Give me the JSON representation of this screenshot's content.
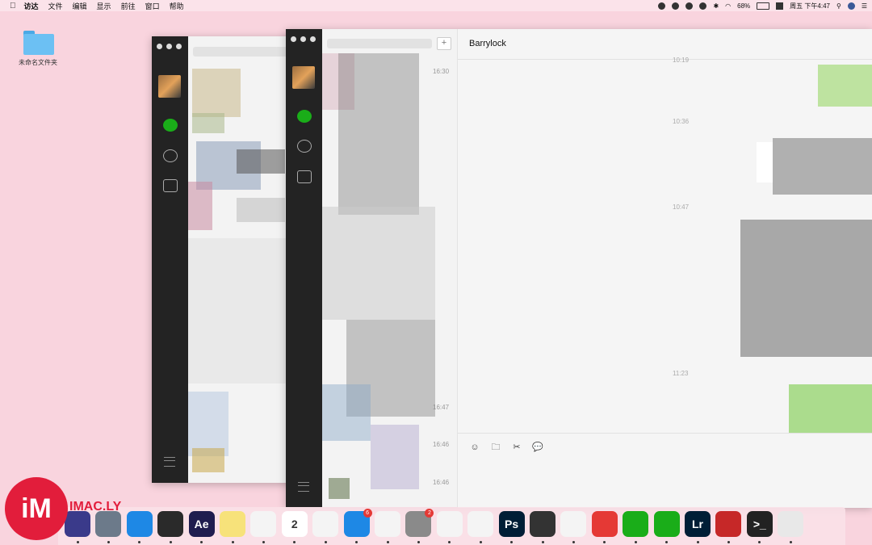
{
  "menubar": {
    "items": [
      "访达",
      "文件",
      "编辑",
      "显示",
      "前往",
      "窗口",
      "帮助"
    ],
    "battery": "68%",
    "clock": "周五 下午4:47"
  },
  "desktop": {
    "folder_label": "未命名文件夹"
  },
  "back_window": {
    "list_items": [
      {
        "time": ""
      },
      {
        "time": ""
      }
    ]
  },
  "front_window": {
    "list_times": [
      "16:30",
      "16:47",
      "16:46",
      "16:46"
    ],
    "add_button": "+"
  },
  "chat": {
    "title": "Barrylock",
    "timestamps": [
      "10:19",
      "10:36",
      "10:47",
      "11:23"
    ]
  },
  "dock": {
    "apps": [
      {
        "name": "siri",
        "label": "",
        "color": "#3a3a8a"
      },
      {
        "name": "launchpad",
        "label": "",
        "color": "#6c7a8a"
      },
      {
        "name": "safari",
        "label": "",
        "color": "#1e88e5"
      },
      {
        "name": "davinci-resolve",
        "label": "",
        "color": "#2a2a2a"
      },
      {
        "name": "after-effects",
        "label": "Ae",
        "color": "#1f1d4f"
      },
      {
        "name": "notes",
        "label": "",
        "color": "#f7e27a"
      },
      {
        "name": "photos",
        "label": "",
        "color": "#f4f4f4"
      },
      {
        "name": "calendar",
        "label": "2",
        "color": "#ffffff"
      },
      {
        "name": "numbers",
        "label": "",
        "color": "#f4f4f4"
      },
      {
        "name": "app-store",
        "label": "",
        "color": "#1e88e5",
        "badge": "6"
      },
      {
        "name": "itunes",
        "label": "",
        "color": "#f4f4f4"
      },
      {
        "name": "system-preferences",
        "label": "",
        "color": "#8a8a8a",
        "badge": "2"
      },
      {
        "name": "baidu-netdisk",
        "label": "",
        "color": "#f4f4f4"
      },
      {
        "name": "preview",
        "label": "",
        "color": "#f4f4f4"
      },
      {
        "name": "photoshop",
        "label": "Ps",
        "color": "#001e36"
      },
      {
        "name": "final-cut-pro",
        "label": "",
        "color": "#333"
      },
      {
        "name": "keynote",
        "label": "",
        "color": "#f4f4f4"
      },
      {
        "name": "netease-music",
        "label": "",
        "color": "#e53935"
      },
      {
        "name": "wechat",
        "label": "",
        "color": "#1aad19"
      },
      {
        "name": "wechat-2",
        "label": "",
        "color": "#1aad19"
      },
      {
        "name": "lightroom",
        "label": "Lr",
        "color": "#001e36"
      },
      {
        "name": "solitaire",
        "label": "",
        "color": "#c62828"
      },
      {
        "name": "terminal",
        "label": ">_",
        "color": "#222"
      },
      {
        "name": "trash",
        "label": "",
        "color": "#e8e8e8"
      }
    ]
  },
  "watermark": {
    "logo": "iM",
    "text": "IMAC.LY"
  }
}
